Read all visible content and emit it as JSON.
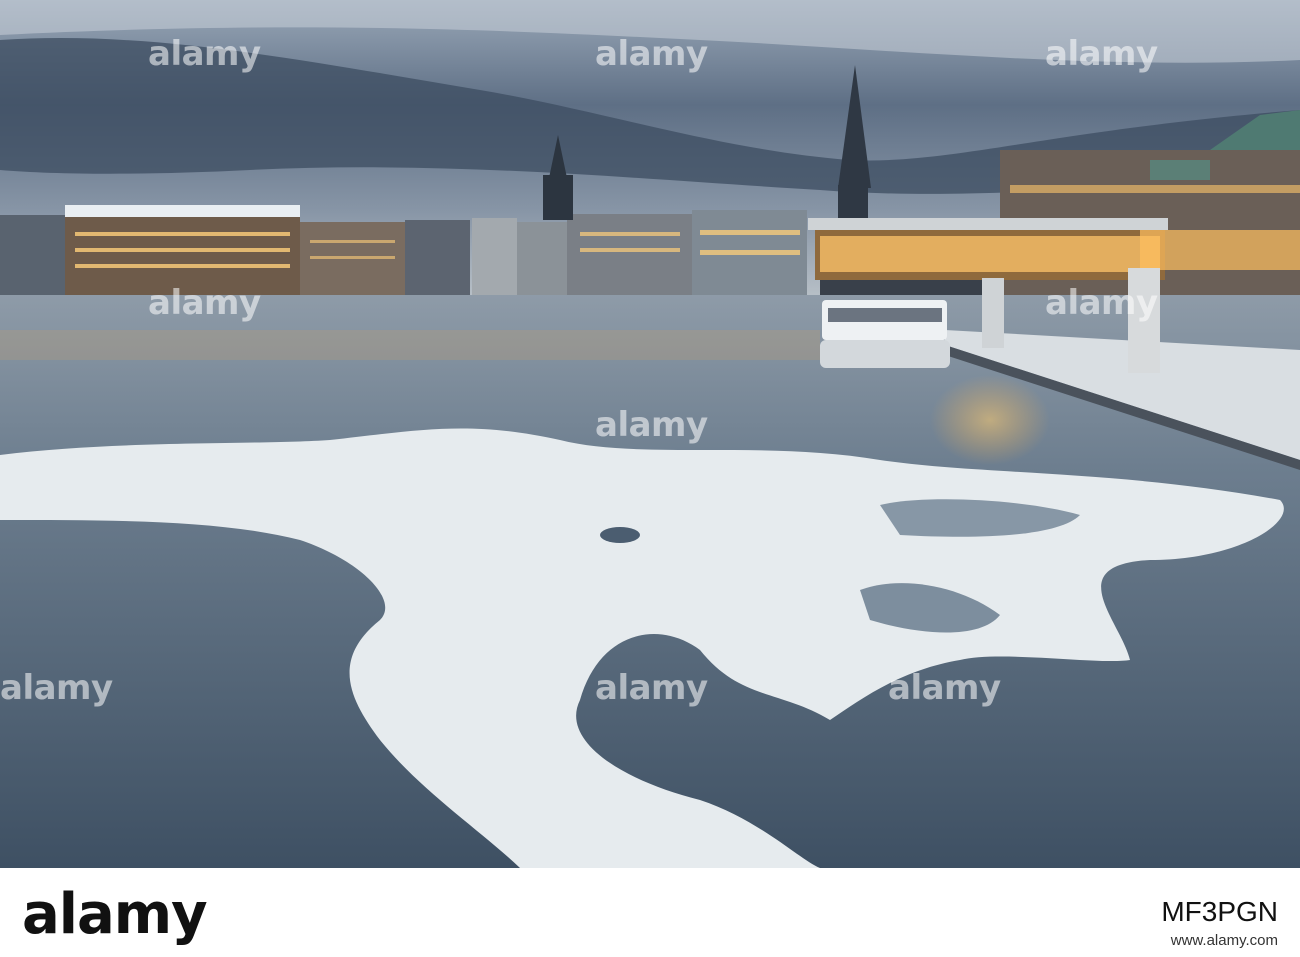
{
  "watermark": {
    "text": "alamy"
  },
  "footer": {
    "brand": "alamy",
    "image_id": "MF3PGN",
    "credit": "www.alamy.com"
  }
}
